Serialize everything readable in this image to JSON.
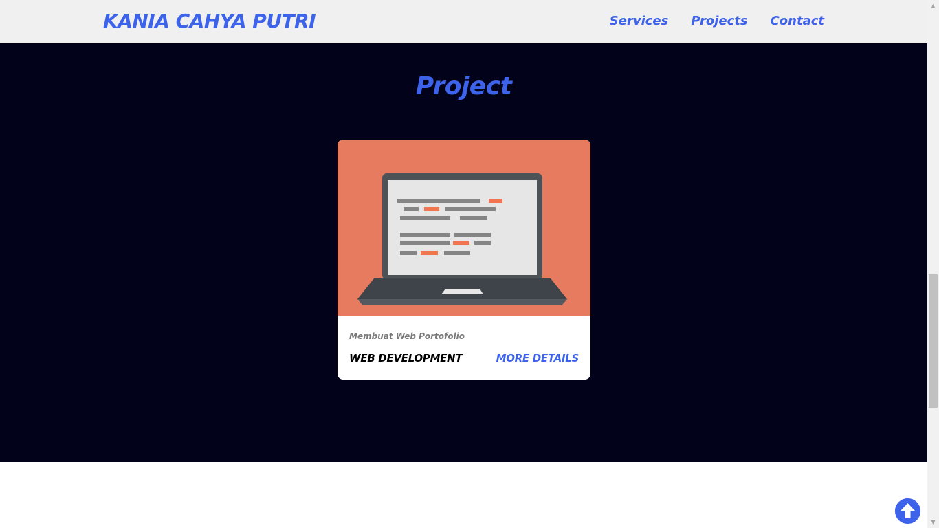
{
  "brand": {
    "name": "KANIA CAHYA PUTRI"
  },
  "nav": {
    "items": [
      {
        "label": "Services"
      },
      {
        "label": "Projects"
      },
      {
        "label": "Contact"
      }
    ]
  },
  "project_section": {
    "title": "Project",
    "card": {
      "image_icon": "laptop-code-icon",
      "subtitle": "Membuat Web Portofolio",
      "category": "WEB DEVELOPMENT",
      "link_label": "MORE DETAILS"
    }
  },
  "back_to_top": {
    "icon": "arrow-up-icon"
  },
  "colors": {
    "accent": "#3d63ea",
    "nav_background": "#f0f0f0",
    "section_background": "#02021a",
    "card_image_background": "#e67b5f",
    "code_highlight": "#f27450"
  }
}
